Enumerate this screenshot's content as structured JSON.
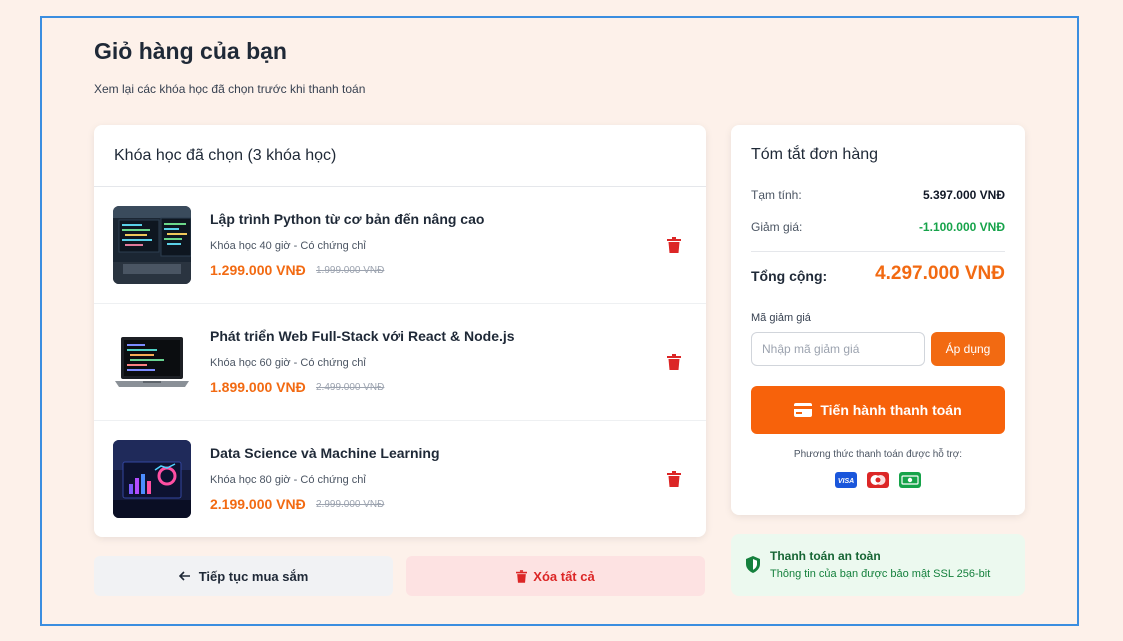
{
  "header": {
    "title": "Giỏ hàng của bạn",
    "subtitle": "Xem lại các khóa học đã chọn trước khi thanh toán"
  },
  "cart": {
    "heading": "Khóa học đã chọn (3 khóa học)",
    "items": [
      {
        "name": "Lập trình Python từ cơ bản đến nâng cao",
        "meta": "Khóa học 40 giờ - Có chứng chỉ",
        "price": "1.299.000 VNĐ",
        "old_price": "1.999.000 VNĐ",
        "thumb_icon": "python-code-thumbnail",
        "delete_icon": "trash-icon"
      },
      {
        "name": "Phát triển Web Full-Stack với React & Node.js",
        "meta": "Khóa học 60 giờ - Có chứng chỉ",
        "price": "1.899.000 VNĐ",
        "old_price": "2.499.000 VNĐ",
        "thumb_icon": "laptop-code-thumbnail",
        "delete_icon": "trash-icon"
      },
      {
        "name": "Data Science và Machine Learning",
        "meta": "Khóa học 80 giờ - Có chứng chỉ",
        "price": "2.199.000 VNĐ",
        "old_price": "2.999.000 VNĐ",
        "thumb_icon": "data-dashboard-thumbnail",
        "delete_icon": "trash-icon"
      }
    ],
    "continue_label": "Tiếp tục mua sắm",
    "clear_label": "Xóa tất cả"
  },
  "summary": {
    "title": "Tóm tắt đơn hàng",
    "subtotal_label": "Tạm tính:",
    "subtotal_value": "5.397.000 VNĐ",
    "discount_label": "Giảm giá:",
    "discount_value": "-1.100.000 VNĐ",
    "total_label": "Tổng cộng:",
    "total_value": "4.297.000 VNĐ",
    "coupon_label": "Mã giảm giá",
    "coupon_placeholder": "Nhập mã giảm giá",
    "coupon_value": "",
    "apply_label": "Áp dụng",
    "checkout_label": "Tiến hành thanh toán",
    "payment_label": "Phương thức thanh toán được hỗ trợ:",
    "payment_methods": [
      "visa-icon",
      "mastercard-icon",
      "cash-icon"
    ]
  },
  "secure": {
    "title": "Thanh toán an toàn",
    "description": "Thông tin của bạn được bảo mật SSL 256-bit"
  },
  "colors": {
    "accent": "#f26a12",
    "discount": "#16a34a",
    "danger": "#dc2626",
    "frame": "#3b8ee0",
    "background": "#fdf1ea"
  }
}
